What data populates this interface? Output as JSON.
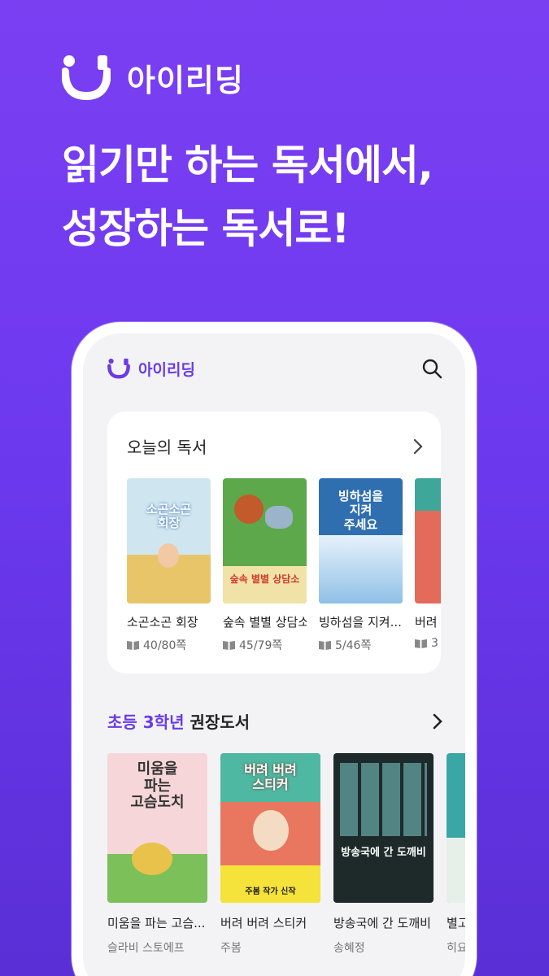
{
  "brand": {
    "name": "아이리딩"
  },
  "headline": {
    "line1": "읽기만 하는 독서에서,",
    "line2": "성장하는 독서로!"
  },
  "app": {
    "name": "아이리딩",
    "today": {
      "title": "오늘의 독서",
      "books": [
        {
          "title": "소곤소곤 회장",
          "pages": "40/80쪽",
          "cover_text": "소곤소곤\n회장",
          "cover_color": "#cfe6f0"
        },
        {
          "title": "숲속 별별 상담소",
          "pages": "45/79쪽",
          "cover_text": "숲속 별별 상담소",
          "cover_color": "#5da84a"
        },
        {
          "title": "빙하섬을 지켜...",
          "pages": "5/46쪽",
          "cover_text": "빙하섬을\n지켜\n주세요",
          "cover_color": "#2f6fb0"
        },
        {
          "title": "버려",
          "pages": "3",
          "cover_text": "",
          "cover_color": "#e46a5a"
        }
      ]
    },
    "recommend": {
      "title_accent": "초등 3학년",
      "title_rest": "권장도서",
      "books": [
        {
          "title": "미움을 파는 고슴...",
          "author": "슬라비 스토에프",
          "cover_text": "미움을\n파는\n고슴도치",
          "cover_color": "#f6d6d9"
        },
        {
          "title": "버려 버려 스티커",
          "author": "주봄",
          "cover_text": "버려 버려\n스티커",
          "cover_color": "#e9775f",
          "cover_banner": "주봄 작가 신작"
        },
        {
          "title": "방송국에 간 도깨비",
          "author": "송혜정",
          "cover_text": "방송국에 간 도깨비",
          "cover_color": "#1e2a2a"
        },
        {
          "title": "별고",
          "author": "히요",
          "cover_text": "",
          "cover_color": "#3aa6a6"
        }
      ]
    }
  }
}
